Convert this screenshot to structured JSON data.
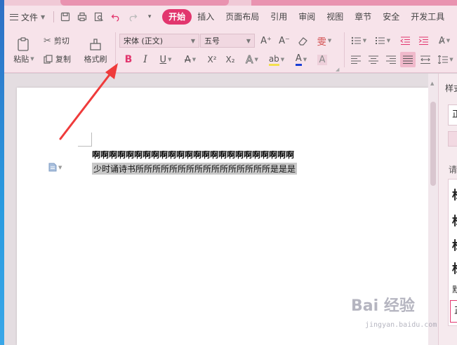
{
  "menubar": {
    "file_label": "文件",
    "tabs": [
      {
        "label": "开始",
        "active": true
      },
      {
        "label": "插入"
      },
      {
        "label": "页面布局"
      },
      {
        "label": "引用"
      },
      {
        "label": "审阅"
      },
      {
        "label": "视图"
      },
      {
        "label": "章节"
      },
      {
        "label": "安全"
      },
      {
        "label": "开发工具"
      }
    ]
  },
  "ribbon": {
    "paste_label": "粘贴",
    "cut_label": "剪切",
    "copy_label": "复制",
    "format_painter_label": "格式刷",
    "font_name": "宋体 (正文)",
    "font_size": "五号",
    "bold_label": "B",
    "italic_label": "I",
    "underline_label": "U",
    "strike_label": "A",
    "superscript_label": "X²",
    "subscript_label": "X₂",
    "effects_label": "A",
    "highlight_label": "ab",
    "font_color_label": "A",
    "char_shading_label": "A",
    "grow_label": "A⁺",
    "shrink_label": "A⁻",
    "phonetic_label": "雯"
  },
  "colors": {
    "accent": "#e2366e",
    "ribbon_bg": "#f7e3ea",
    "arrow": "#ef3b3b",
    "highlight": "#f4e04d",
    "font_color": "#1a3fd6"
  },
  "document": {
    "line1": "啊啊啊啊啊啊啊啊啊啊啊啊啊啊啊啊啊啊啊啊啊啊啊啊",
    "line2": "少时诵诗书所所所所所所所所所所所所所所所所是是是"
  },
  "side_pane": {
    "title": "样式",
    "current_style": "正",
    "hint": "请",
    "styles": [
      "标",
      "标",
      "标",
      "标"
    ],
    "small_label": "默",
    "bottom_style": "正"
  },
  "watermark": {
    "main": "Bai 经验",
    "sub": "jingyan.baidu.com"
  }
}
